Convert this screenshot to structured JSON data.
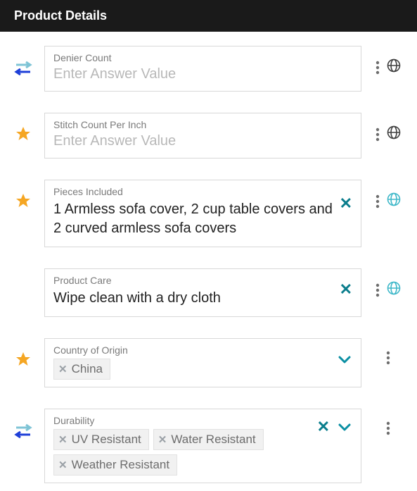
{
  "section": {
    "title": "Product Details"
  },
  "fields": {
    "denier": {
      "label": "Denier Count",
      "placeholder": "Enter Answer Value"
    },
    "stitch": {
      "label": "Stitch Count Per Inch",
      "placeholder": "Enter Answer Value"
    },
    "pieces": {
      "label": "Pieces Included",
      "value": "1 Armless sofa cover, 2 cup table covers and 2 curved armless sofa covers"
    },
    "care": {
      "label": "Product Care",
      "value": "Wipe clean with a dry cloth"
    },
    "country": {
      "label": "Country of Origin",
      "tags": {
        "0": "China"
      }
    },
    "durability": {
      "label": "Durability",
      "tags": {
        "0": "UV Resistant",
        "1": "Water Resistant",
        "2": "Weather Resistant"
      }
    }
  }
}
